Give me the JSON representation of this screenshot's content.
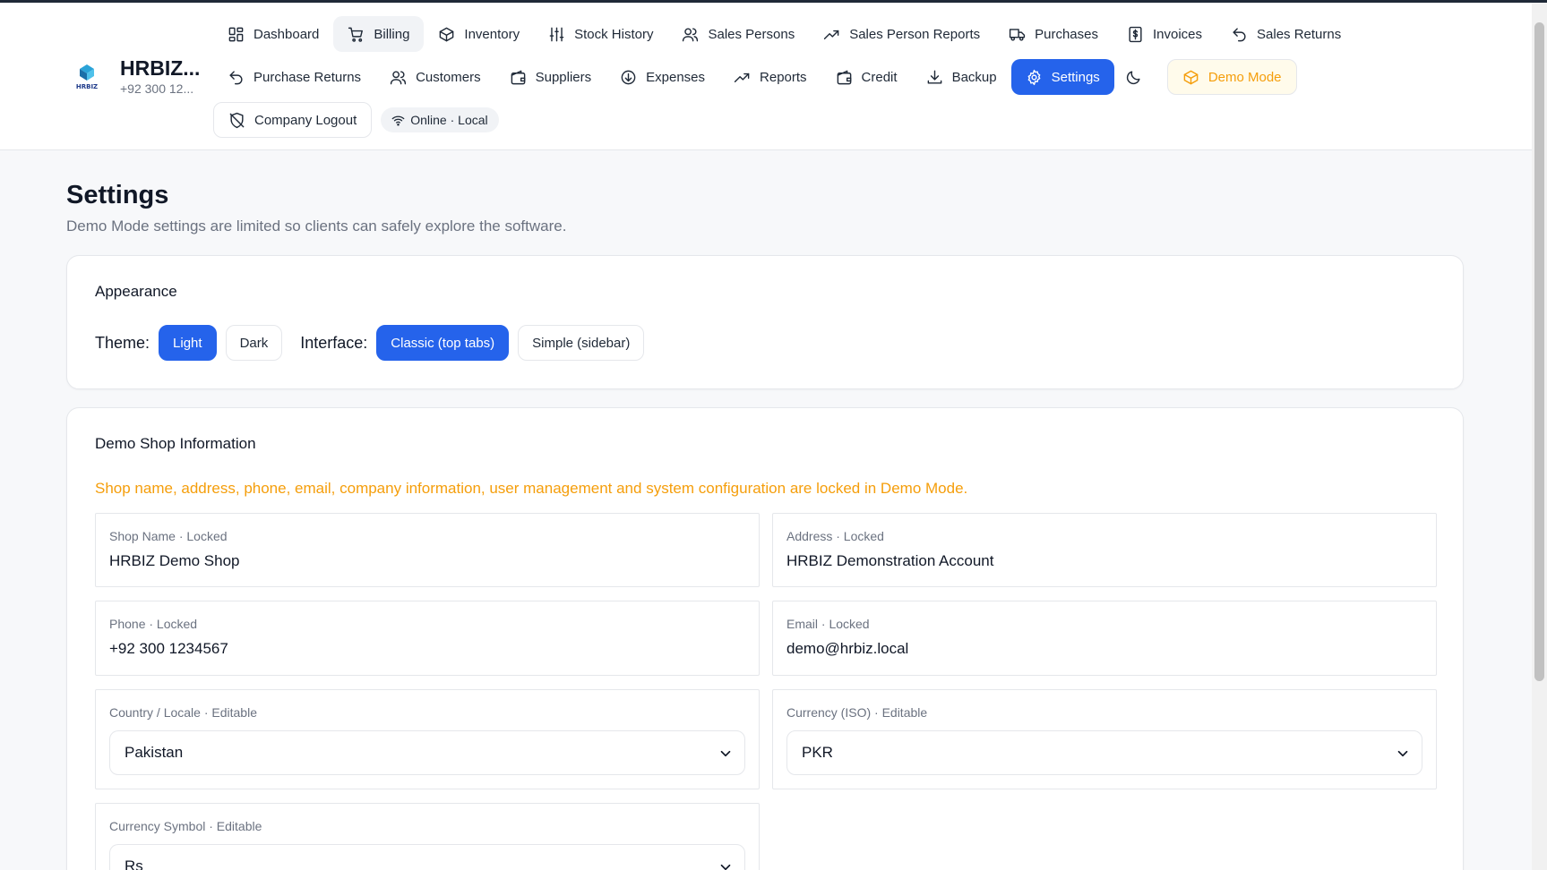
{
  "brand": {
    "name": "HRBIZ...",
    "phone": "+92 300 12...",
    "logo_icon": "hrbiz-logo-icon"
  },
  "nav": {
    "row1": [
      {
        "label": "Dashboard",
        "icon": "grid-icon"
      },
      {
        "label": "Billing",
        "icon": "cart-icon"
      },
      {
        "label": "Inventory",
        "icon": "box-icon"
      },
      {
        "label": "Stock History",
        "icon": "sliders-icon"
      },
      {
        "label": "Sales Persons",
        "icon": "users-icon"
      },
      {
        "label": "Sales Person Reports",
        "icon": "trending-up-icon"
      },
      {
        "label": "Purchases",
        "icon": "truck-icon"
      },
      {
        "label": "Invoices",
        "icon": "dollar-file-icon"
      },
      {
        "label": "Sales Returns",
        "icon": "undo-icon"
      }
    ],
    "row2": [
      {
        "label": "Purchase Returns",
        "icon": "undo-icon"
      },
      {
        "label": "Customers",
        "icon": "users-icon"
      },
      {
        "label": "Suppliers",
        "icon": "wallet-icon"
      },
      {
        "label": "Expenses",
        "icon": "arrow-down-circle-icon"
      },
      {
        "label": "Reports",
        "icon": "trending-up-icon"
      },
      {
        "label": "Credit",
        "icon": "wallet-icon"
      },
      {
        "label": "Backup",
        "icon": "download-icon"
      },
      {
        "label": "Settings",
        "icon": "gear-icon"
      },
      {
        "label": "",
        "icon": "moon-icon"
      },
      {
        "label": "Demo Mode",
        "icon": "cube-icon"
      }
    ],
    "logout_label": "Company Logout",
    "status_label": "Online · Local"
  },
  "page": {
    "title": "Settings",
    "subtitle": "Demo Mode settings are limited so clients can safely explore the software."
  },
  "appearance": {
    "title": "Appearance",
    "theme_label": "Theme:",
    "theme_options": [
      "Light",
      "Dark"
    ],
    "theme_selected": "Light",
    "interface_label": "Interface:",
    "interface_options": [
      "Classic (top tabs)",
      "Simple (sidebar)"
    ],
    "interface_selected": "Classic (top tabs)"
  },
  "shop": {
    "title": "Demo Shop Information",
    "notice": "Shop name, address, phone, email, company information, user management and system configuration are locked in Demo Mode.",
    "fields": {
      "shop_name": {
        "label": "Shop Name · Locked",
        "value": "HRBIZ Demo Shop"
      },
      "address": {
        "label": "Address · Locked",
        "value": "HRBIZ Demonstration Account"
      },
      "phone": {
        "label": "Phone · Locked",
        "value": "+92 300 1234567"
      },
      "email": {
        "label": "Email · Locked",
        "value": "demo@hrbiz.local"
      },
      "country": {
        "label": "Country / Locale · Editable",
        "value": "Pakistan"
      },
      "currency": {
        "label": "Currency (ISO) · Editable",
        "value": "PKR"
      },
      "currency_symbol": {
        "label": "Currency Symbol · Editable",
        "value": "Rs"
      }
    }
  },
  "colors": {
    "accent": "#2563eb",
    "warning": "#f59e0b",
    "text": "#111827",
    "muted": "#6b7280"
  }
}
